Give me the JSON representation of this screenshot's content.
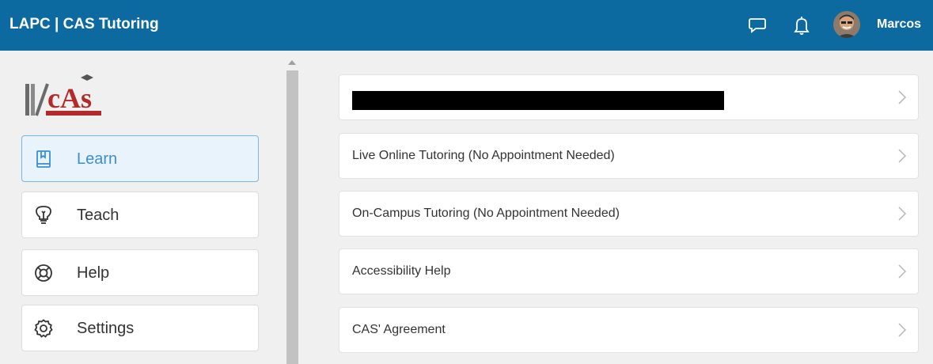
{
  "header": {
    "title": "LAPC | CAS Tutoring",
    "user_name": "Marcos",
    "icons": [
      "chat-icon",
      "bell-icon",
      "avatar"
    ]
  },
  "sidebar": {
    "logo_text": "CAS",
    "items": [
      {
        "label": "Learn",
        "icon": "book-icon",
        "active": true
      },
      {
        "label": "Teach",
        "icon": "lightbulb-icon",
        "active": false
      },
      {
        "label": "Help",
        "icon": "lifebuoy-icon",
        "active": false
      },
      {
        "label": "Settings",
        "icon": "gear-icon",
        "active": false
      }
    ]
  },
  "main": {
    "items": [
      {
        "label": "",
        "redacted": true
      },
      {
        "label": "Live Online Tutoring (No Appointment Needed)"
      },
      {
        "label": "On-Campus Tutoring (No Appointment Needed)"
      },
      {
        "label": "Accessibility Help"
      },
      {
        "label": "CAS' Agreement"
      }
    ]
  },
  "colors": {
    "header_bg": "#0c6aa0",
    "accent": "#3a8fd0",
    "active_bg": "#e9f3fb"
  }
}
